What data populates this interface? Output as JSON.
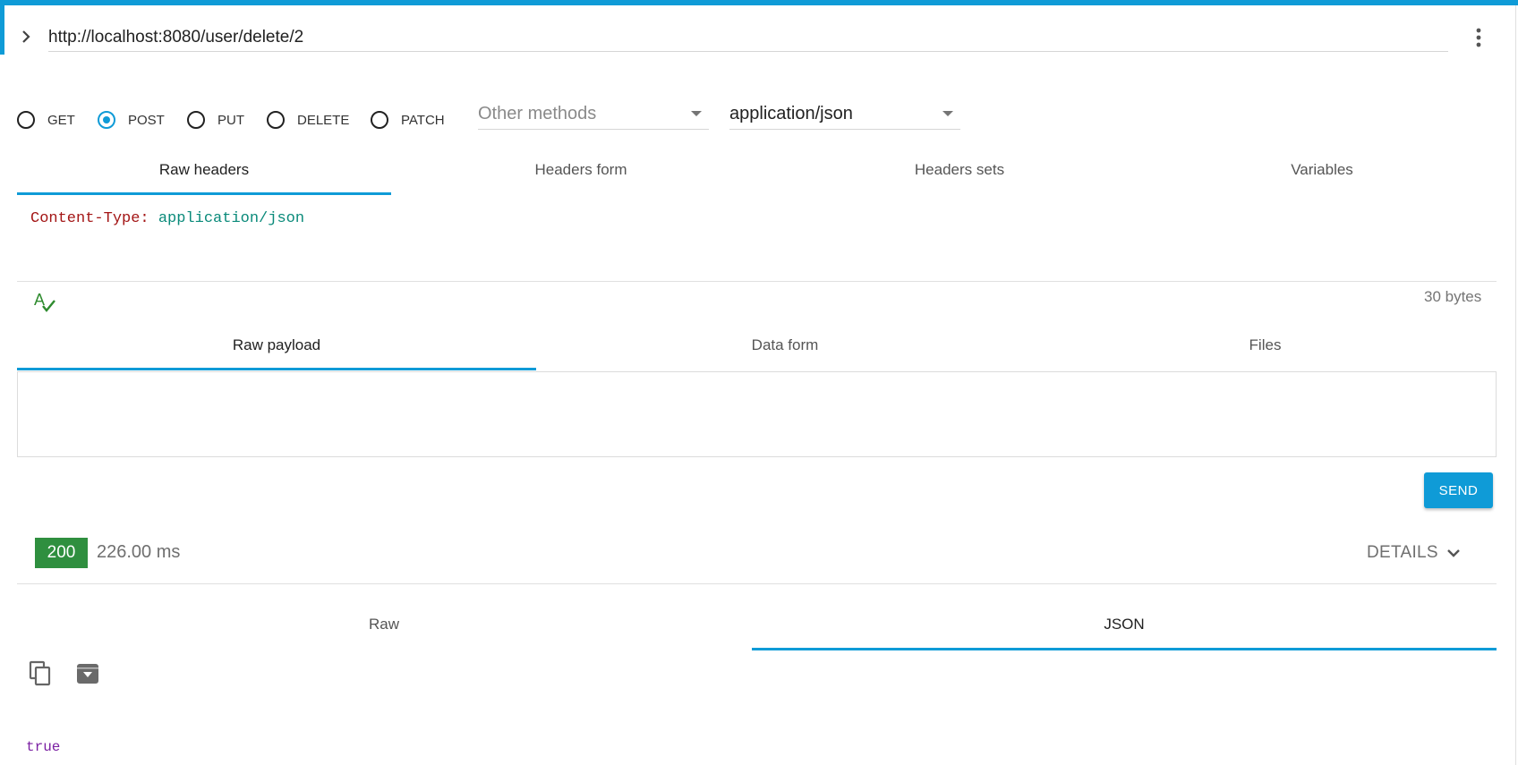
{
  "colors": {
    "accent": "#0f9bd7",
    "status_ok": "#2f8f3f",
    "header_key": "#a31515",
    "header_value": "#0a8a7a",
    "json_value": "#7a1fa2"
  },
  "request": {
    "url": "http://localhost:8080/user/delete/2",
    "methods": [
      {
        "label": "GET",
        "checked": false
      },
      {
        "label": "POST",
        "checked": true
      },
      {
        "label": "PUT",
        "checked": false
      },
      {
        "label": "DELETE",
        "checked": false
      },
      {
        "label": "PATCH",
        "checked": false
      }
    ],
    "other_methods_placeholder": "Other methods",
    "content_type": "application/json"
  },
  "header_tabs": [
    "Raw headers",
    "Headers form",
    "Headers sets",
    "Variables"
  ],
  "headers_editor": {
    "key": "Content-Type:",
    "value": "application/json"
  },
  "headers_size": "30 bytes",
  "payload_tabs": [
    "Raw payload",
    "Data form",
    "Files"
  ],
  "send_label": "SEND",
  "response": {
    "status_code": "200",
    "time": "226.00 ms",
    "details_label": "DETAILS",
    "tabs": [
      "Raw",
      "JSON"
    ],
    "active_tab": "JSON",
    "body": "true"
  },
  "icons": {
    "expand": "chevron-right-icon",
    "more": "more-vert-icon",
    "headers_validator": "spellcheck-icon",
    "copy": "copy-icon",
    "save": "archive-icon"
  }
}
